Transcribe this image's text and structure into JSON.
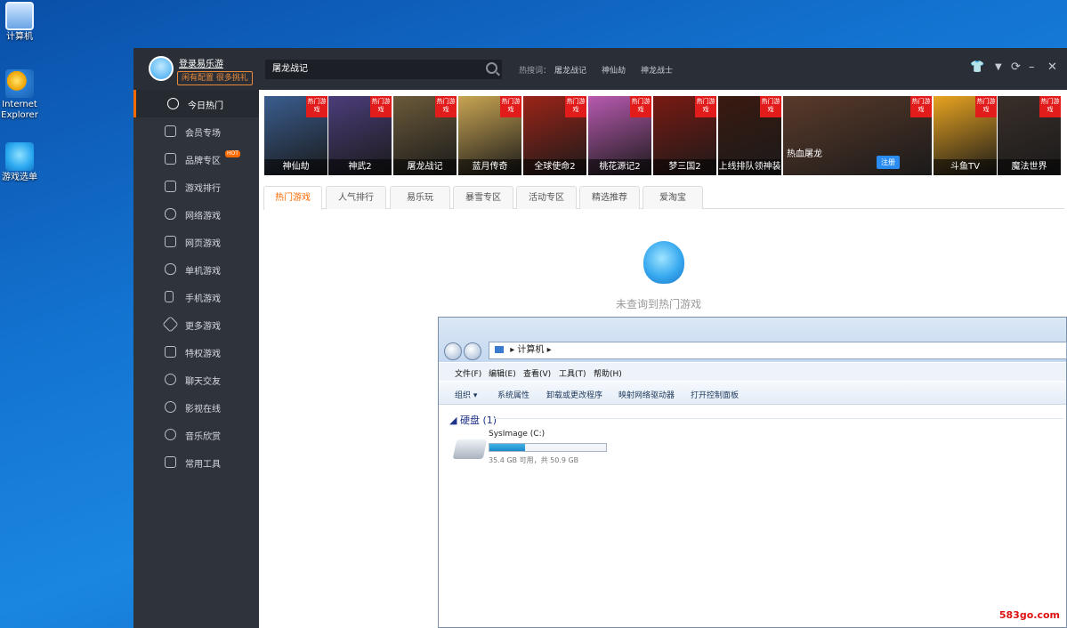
{
  "desktop": {
    "icons": [
      {
        "label": "计算机"
      },
      {
        "label": "Internet Explorer"
      },
      {
        "label": "游戏选单"
      }
    ]
  },
  "app": {
    "login_link": "登录易乐游",
    "login_badge": "闲有配置 很多挑礼",
    "search_value": "屠龙战记",
    "hot_search_label": "热搜词：",
    "hot_search_terms": [
      "屠龙战记",
      "神仙劫",
      "神龙战士"
    ],
    "window_controls": [
      "shirt",
      "dropdown",
      "refresh",
      "minimize",
      "close"
    ],
    "sidebar": {
      "items": [
        {
          "label": "今日热门",
          "icon": "hot-icon"
        },
        {
          "label": "会员专场",
          "icon": "member-icon"
        },
        {
          "label": "品牌专区",
          "icon": "thumb-icon",
          "tag": "HOT"
        },
        {
          "label": "游戏排行",
          "icon": "rank-icon"
        },
        {
          "label": "网络游戏",
          "icon": "mouse-icon"
        },
        {
          "label": "网页游戏",
          "icon": "browser-icon"
        },
        {
          "label": "单机游戏",
          "icon": "gamepad-icon"
        },
        {
          "label": "手机游戏",
          "icon": "phone-icon"
        },
        {
          "label": "更多游戏",
          "icon": "more-icon"
        },
        {
          "label": "特权游戏",
          "icon": "gift-icon"
        },
        {
          "label": "聊天交友",
          "icon": "chat-icon"
        },
        {
          "label": "影视在线",
          "icon": "film-icon"
        },
        {
          "label": "音乐欣赏",
          "icon": "music-icon"
        },
        {
          "label": "常用工具",
          "icon": "tools-icon"
        }
      ]
    },
    "banners": [
      {
        "caption": "神仙劫",
        "ribbon": "热门游戏",
        "color": "#3a5d8f"
      },
      {
        "caption": "神武2",
        "ribbon": "热门游戏",
        "color": "#4b3d7a"
      },
      {
        "caption": "屠龙战记",
        "ribbon": "热门游戏",
        "color": "#6b5a3a"
      },
      {
        "caption": "蓝月传奇",
        "ribbon": "热门游戏",
        "color": "#c9a552"
      },
      {
        "caption": "全球使命2",
        "ribbon": "热门游戏",
        "color": "#9c2418"
      },
      {
        "caption": "桃花源记2",
        "ribbon": "热门游戏",
        "color": "#b85ab0"
      },
      {
        "caption": "梦三国2",
        "ribbon": "热门游戏",
        "color": "#7a1a12"
      },
      {
        "caption": "上线排队领神装",
        "ribbon": "热门游戏",
        "color": "#3a1a10"
      },
      {
        "caption": "热血屠龙",
        "ribbon": "热门游戏",
        "color": "#5a3a2a",
        "button": "注册"
      },
      {
        "caption": "斗鱼TV",
        "ribbon": "热门游戏",
        "color": "#e8a420"
      },
      {
        "caption": "魔法世界",
        "ribbon": "热门游戏",
        "color": "#3a2f2a"
      }
    ],
    "tabs": [
      "热门游戏",
      "人气排行",
      "易乐玩",
      "暴雪专区",
      "活动专区",
      "精选推荐",
      "爱淘宝"
    ],
    "empty_text": "未查询到热门游戏"
  },
  "explorer": {
    "address": "计算机",
    "menus": [
      "文件(F)",
      "编辑(E)",
      "查看(V)",
      "工具(T)",
      "帮助(H)"
    ],
    "toolbar": [
      "组织 ▾",
      "系统属性",
      "卸载或更改程序",
      "映射网络驱动器",
      "打开控制面板"
    ],
    "group_title": "硬盘 (1)",
    "drive": {
      "name": "SysImage (C:)",
      "info": "35.4 GB 可用，共 50.9 GB",
      "used_fraction": 0.305
    }
  },
  "watermark": "583go.com"
}
